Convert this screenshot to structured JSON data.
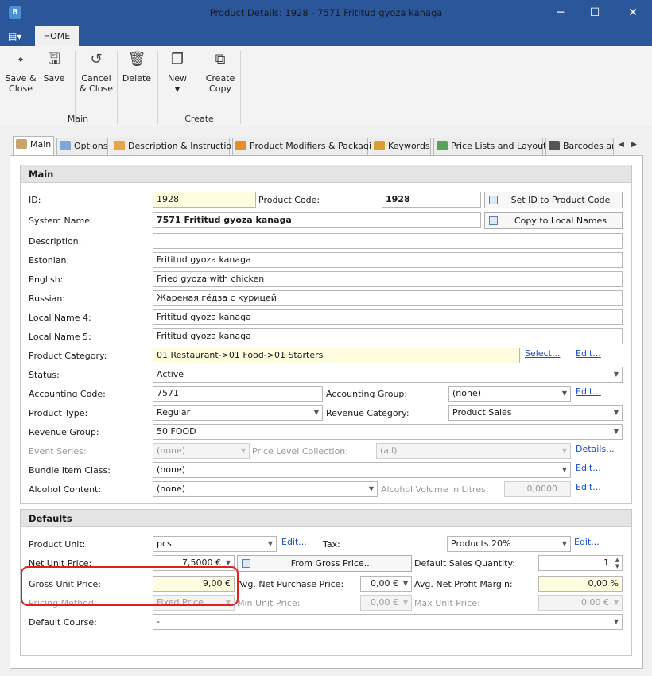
{
  "window": {
    "title": "Product Details: 1928 - 7571 Frititud gyoza kanaga",
    "app_icon": "B",
    "minimize": "─",
    "maximize": "☐",
    "close": "✕"
  },
  "ribbon": {
    "tab": "HOME",
    "menu_icon": "▤▾",
    "buttons": {
      "save_close": "Save & Close",
      "save": "Save",
      "cancel_close": "Cancel & Close",
      "delete": "Delete",
      "new": "New",
      "create_copy": "Create Copy"
    },
    "groups": {
      "main": "Main",
      "create": "Create"
    }
  },
  "tabs": [
    "Main",
    "Options",
    "Description & Instructions",
    "Product Modifiers & Packaging",
    "Keywords",
    "Price Lists and Layouts",
    "Barcodes and"
  ],
  "main_section": {
    "title": "Main",
    "id_label": "ID:",
    "id": "1928",
    "product_code_label": "Product Code:",
    "product_code": "1928",
    "set_id_button": "Set ID to Product Code",
    "system_name_label": "System Name:",
    "system_name": "7571 Frititud gyoza kanaga",
    "copy_names_button": "Copy to Local Names",
    "description_label": "Description:",
    "description": "",
    "estonian_label": "Estonian:",
    "estonian": "Frititud gyoza kanaga",
    "english_label": "English:",
    "english": "Fried gyoza with chicken",
    "russian_label": "Russian:",
    "russian": "Жареная гёдза с курицей",
    "local4_label": "Local Name 4:",
    "local4": "Frititud gyoza kanaga",
    "local5_label": "Local Name 5:",
    "local5": "Frititud gyoza kanaga",
    "category_label": "Product Category:",
    "category": "01 Restaurant->01 Food->01 Starters",
    "select_link": "Select...",
    "edit_link": "Edit...",
    "status_label": "Status:",
    "status": "Active",
    "acc_code_label": "Accounting Code:",
    "acc_code": "7571",
    "acc_group_label": "Accounting Group:",
    "acc_group": "(none)",
    "ptype_label": "Product Type:",
    "ptype": "Regular",
    "rev_cat_label": "Revenue Category:",
    "rev_cat": "Product Sales",
    "rev_group_label": "Revenue Group:",
    "rev_group": "50 FOOD",
    "event_label": "Event Series:",
    "event": "(none)",
    "plc_label": "Price Level Collection:",
    "plc": "(all)",
    "details_link": "Details...",
    "bundle_label": "Bundle Item Class:",
    "bundle": "(none)",
    "alcohol_label": "Alcohol Content:",
    "alcohol": "(none)",
    "alc_vol_label": "Alcohol Volume in Litres:",
    "alc_vol": "0,0000"
  },
  "defaults_section": {
    "title": "Defaults",
    "unit_label": "Product Unit:",
    "unit": "pcs",
    "tax_label": "Tax:",
    "tax": "Products 20%",
    "net_label": "Net Unit Price:",
    "net": "7,5000 €",
    "from_gross_button": "From Gross Price...",
    "dsq_label": "Default Sales Quantity:",
    "dsq": "1",
    "gross_label": "Gross Unit Price:",
    "gross": "9,00 €",
    "anpp_label": "Avg. Net Purchase Price:",
    "anpp": "0,00 €",
    "anpm_label": "Avg. Net Profit Margin:",
    "anpm": "0,00 %",
    "pm_label": "Pricing Method:",
    "pm": "Fixed Price",
    "min_label": "Min Unit Price:",
    "min": "0,00 €",
    "max_label": "Max Unit Price:",
    "max": "0,00 €",
    "course_label": "Default Course:",
    "course": "-"
  },
  "colors": {
    "titlebar": "#2b579a",
    "highlight": "#e0201c",
    "link": "#1a4fc4"
  }
}
